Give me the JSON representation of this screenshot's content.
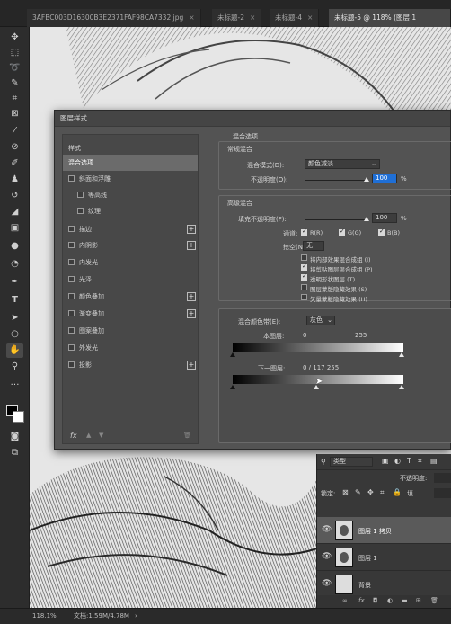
{
  "tabs": [
    {
      "label": "3AFBC003D16300B3E2371FAF98CA7332.jpg",
      "active": false
    },
    {
      "label": "未标题-2",
      "active": false
    },
    {
      "label": "未标题-4",
      "active": false
    },
    {
      "label": "未标题-5 @ 118% (图层 1",
      "active": true
    }
  ],
  "tools": [
    "move-tool-icon",
    "marquee-tool-icon",
    "lasso-tool-icon",
    "quick-select-icon",
    "crop-tool-icon",
    "frame-tool-icon",
    "eyedropper-icon",
    "spot-heal-icon",
    "brush-tool-icon",
    "clone-stamp-icon",
    "history-brush-icon",
    "eraser-icon",
    "gradient-icon",
    "blur-icon",
    "dodge-icon",
    "pen-tool-icon",
    "type-tool-icon",
    "path-select-icon",
    "ellipse-tool-icon",
    "hand-tool-icon",
    "zoom-tool-icon",
    "more-tools-icon"
  ],
  "dialog": {
    "title": "图层样式",
    "styles_header": "样式",
    "style_items": [
      {
        "label": "混合选项",
        "selected": true,
        "checkbox": false,
        "plus": false
      },
      {
        "label": "斜面和浮雕",
        "checkbox": true,
        "plus": false
      },
      {
        "label": "等高线",
        "checkbox": true,
        "indent": true,
        "plus": false
      },
      {
        "label": "纹理",
        "checkbox": true,
        "indent": true,
        "plus": false
      },
      {
        "label": "描边",
        "checkbox": true,
        "plus": true
      },
      {
        "label": "内阴影",
        "checkbox": true,
        "plus": true
      },
      {
        "label": "内发光",
        "checkbox": true,
        "plus": false
      },
      {
        "label": "光泽",
        "checkbox": true,
        "plus": false
      },
      {
        "label": "颜色叠加",
        "checkbox": true,
        "plus": true
      },
      {
        "label": "渐变叠加",
        "checkbox": true,
        "plus": true
      },
      {
        "label": "图案叠加",
        "checkbox": true,
        "plus": false
      },
      {
        "label": "外发光",
        "checkbox": true,
        "plus": false
      },
      {
        "label": "投影",
        "checkbox": true,
        "plus": true
      }
    ],
    "footer_fx": "fx",
    "blend_options_title": "混合选项",
    "general_title": "常规混合",
    "blend_mode_label": "混合模式(D):",
    "blend_mode_value": "颜色减淡",
    "opacity_label": "不透明度(O):",
    "opacity_value": "100",
    "percent": "%",
    "advanced_title": "高级混合",
    "fill_opacity_label": "填充不透明度(F):",
    "fill_opacity_value": "100",
    "channels_label": "通道:",
    "channel_r": "R(R)",
    "channel_g": "G(G)",
    "channel_b": "B(B)",
    "knockout_label": "挖空(N):",
    "knockout_value": "无",
    "options": [
      {
        "label": "将内部效果混合成组 (I)",
        "checked": false
      },
      {
        "label": "将剪贴图层混合成组 (P)",
        "checked": true
      },
      {
        "label": "透明形状图层 (T)",
        "checked": true
      },
      {
        "label": "图层蒙版隐藏效果 (S)",
        "checked": false
      },
      {
        "label": "矢量蒙版隐藏效果 (H)",
        "checked": false
      }
    ],
    "blend_if_label": "混合颜色带(E):",
    "blend_if_value": "灰色",
    "this_layer_label": "本图层:",
    "this_layer_low": "0",
    "this_layer_high": "255",
    "underlying_label": "下一图层:",
    "underlying_values": "0  /  117    255"
  },
  "layers_panel": {
    "search_placeholder": "类型",
    "opacity_label": "不透明度:",
    "lock_label": "锁定:",
    "fill_label": "填",
    "layers": [
      {
        "name": "图层 1 拷贝",
        "selected": true
      },
      {
        "name": "图层 1",
        "selected": false
      },
      {
        "name": "背景",
        "selected": false
      }
    ]
  },
  "status": {
    "zoom": "118.1%",
    "doc": "文档:1.59M/4.78M"
  }
}
